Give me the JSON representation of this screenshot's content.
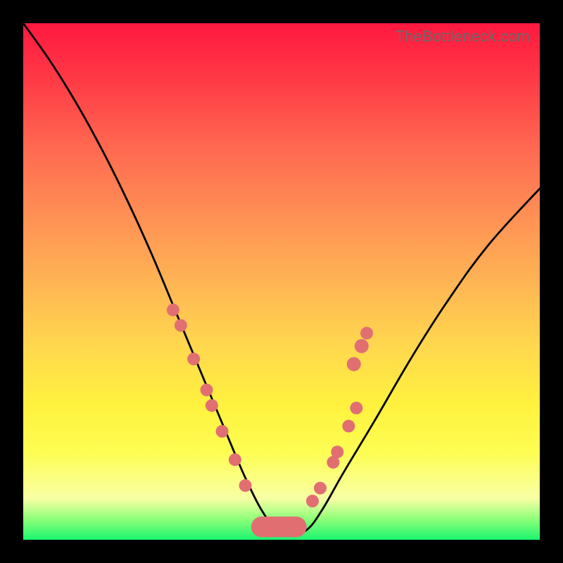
{
  "watermark": "TheBottleneck.com",
  "colors": {
    "dot": "#e16f72",
    "curve": "#000000",
    "frame": "#000000"
  },
  "chart_data": {
    "type": "line",
    "title": "",
    "xlabel": "",
    "ylabel": "",
    "xlim": [
      0,
      100
    ],
    "ylim": [
      0,
      100
    ],
    "grid": false,
    "legend": false,
    "series": [
      {
        "name": "bottleneck-curve",
        "x": [
          0,
          5,
          10,
          15,
          20,
          25,
          30,
          35,
          40,
          43,
          46,
          49,
          52,
          55,
          58,
          62,
          68,
          75,
          82,
          90,
          100
        ],
        "y": [
          100,
          93,
          85,
          76,
          66,
          55,
          43,
          31,
          19,
          12,
          6,
          2,
          1,
          2,
          6,
          13,
          23,
          35,
          46,
          57,
          68
        ]
      }
    ],
    "dots_left": [
      {
        "x": 29.0,
        "y": 44.5,
        "r": 9
      },
      {
        "x": 30.5,
        "y": 41.5,
        "r": 9
      },
      {
        "x": 33.0,
        "y": 35.0,
        "r": 9
      },
      {
        "x": 35.5,
        "y": 29.0,
        "r": 9
      },
      {
        "x": 36.5,
        "y": 26.0,
        "r": 9
      },
      {
        "x": 38.5,
        "y": 21.0,
        "r": 9
      },
      {
        "x": 41.0,
        "y": 15.5,
        "r": 9
      },
      {
        "x": 43.0,
        "y": 10.5,
        "r": 9
      }
    ],
    "dots_right": [
      {
        "x": 56.0,
        "y": 7.5,
        "r": 9
      },
      {
        "x": 57.5,
        "y": 10.0,
        "r": 9
      },
      {
        "x": 60.0,
        "y": 15.0,
        "r": 9
      },
      {
        "x": 60.8,
        "y": 17.0,
        "r": 9
      },
      {
        "x": 63.0,
        "y": 22.0,
        "r": 9
      },
      {
        "x": 64.5,
        "y": 25.5,
        "r": 9
      },
      {
        "x": 64.0,
        "y": 34.0,
        "r": 10
      },
      {
        "x": 65.5,
        "y": 37.5,
        "r": 10
      },
      {
        "x": 66.5,
        "y": 40.0,
        "r": 9
      }
    ],
    "bottom_blob": {
      "x_start": 44.0,
      "x_end": 55.0,
      "y_center": 2.5,
      "half_height": 2.0
    }
  }
}
